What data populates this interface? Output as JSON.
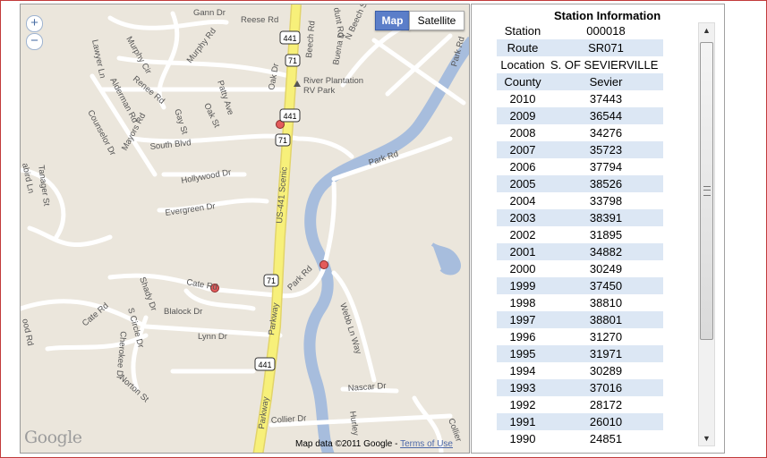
{
  "map": {
    "zoom_in": "+",
    "zoom_out": "−",
    "map_button": "Map",
    "satellite_button": "Satellite",
    "logo": "Google",
    "attribution": "Map data ©2011 Google - ",
    "terms_link": "Terms of Use",
    "labels": {
      "gann": "Gann Dr",
      "reese": "Reese Rd",
      "murphy_rd": "Murphy Rd",
      "murphy_cir": "Murphy Cir",
      "lawyer": "Lawyer Ln",
      "alderman": "Alderman Rd",
      "renee": "Renee Rd",
      "patty": "Patty Ave",
      "oak_dr": "Oak Dr",
      "beech": "Beech Rd",
      "buena": "Buena D",
      "beech_st": "N Beech St",
      "oak_st": "Oak St",
      "counselor": "Counselor Dr",
      "mayors": "Mayors Rd",
      "gay": "Gay St",
      "river_plantation_1": "River Plantation",
      "river_plantation_2": "RV Park",
      "park_rd_top": "Park Rd",
      "south_blvd": "South Blvd",
      "tanager": "Tanager St",
      "hollywood": "Hollywood Dr",
      "evergreen": "Evergreen Dr",
      "us441scenic": "US-441 Scenic",
      "park_rd_mid": "Park Rd",
      "park_rd_low": "Park Rd",
      "cate_rd": "Cate Rd",
      "cate_rd2": "Cate Rd",
      "shady": "Shady Dr",
      "blalock": "Blalock Dr",
      "circle": "S Circle Dr",
      "lynn": "Lynn Dr",
      "cherokee": "Cherokee Dr",
      "norton": "Norton St",
      "webb": "Webb Ln Way",
      "parkway1": "Parkway",
      "parkway2": "Parkway",
      "nascar": "Nascar Dr",
      "collier": "Collier Dr",
      "collier2": "Collier",
      "hurley": "Hurley",
      "wood_rd": "ood Rd",
      "pabird": "abird Ln",
      "dunt": "dunt Rd",
      "park_edge": "Park Rd",
      "sh_441_a": "441",
      "sh_71_a": "71",
      "sh_441_b": "441",
      "sh_71_b": "71",
      "sh_71_c": "71",
      "sh_441_c": "441"
    }
  },
  "panel": {
    "title": "Station Information",
    "station_label": "Station",
    "station_value": "000018",
    "route_label": "Route",
    "route_value": "SR071",
    "location_label": "Location",
    "location_value": "S. OF SEVIERVILLE",
    "county_label": "County",
    "county_value": "Sevier",
    "years": [
      {
        "year": "2010",
        "count": "37443"
      },
      {
        "year": "2009",
        "count": "36544"
      },
      {
        "year": "2008",
        "count": "34276"
      },
      {
        "year": "2007",
        "count": "35723"
      },
      {
        "year": "2006",
        "count": "37794"
      },
      {
        "year": "2005",
        "count": "38526"
      },
      {
        "year": "2004",
        "count": "33798"
      },
      {
        "year": "2003",
        "count": "38391"
      },
      {
        "year": "2002",
        "count": "31895"
      },
      {
        "year": "2001",
        "count": "34882"
      },
      {
        "year": "2000",
        "count": "30249"
      },
      {
        "year": "1999",
        "count": "37450"
      },
      {
        "year": "1998",
        "count": "38810"
      },
      {
        "year": "1997",
        "count": "38801"
      },
      {
        "year": "1996",
        "count": "31270"
      },
      {
        "year": "1995",
        "count": "31971"
      },
      {
        "year": "1994",
        "count": "30289"
      },
      {
        "year": "1993",
        "count": "37016"
      },
      {
        "year": "1992",
        "count": "28172"
      },
      {
        "year": "1991",
        "count": "26010"
      },
      {
        "year": "1990",
        "count": "24851"
      }
    ],
    "scroll_up": "▲",
    "scroll_down": "▼"
  },
  "colors": {
    "highway": "#f7f07a",
    "river": "#a7bddd",
    "land": "#ebe6dc",
    "row_shade": "#dce7f4",
    "marker": "#e35b5b"
  }
}
